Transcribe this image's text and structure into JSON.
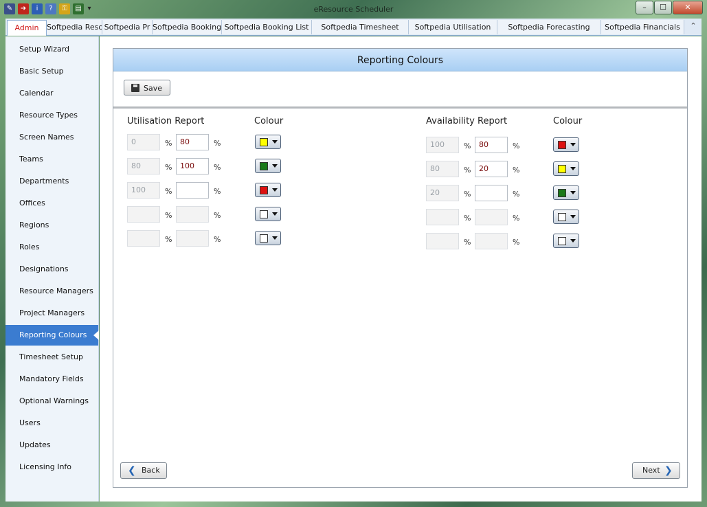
{
  "window": {
    "title": "eResource Scheduler"
  },
  "tabs": [
    "Admin",
    "Softpedia Reso",
    "Softpedia Pr",
    "Softpedia Booking",
    "Softpedia Booking List",
    "Softpedia Timesheet",
    "Softpedia Utilisation",
    "Softpedia Forecasting",
    "Softpedia Financials"
  ],
  "sidebar": [
    "Setup Wizard",
    "Basic Setup",
    "Calendar",
    "Resource Types",
    "Screen Names",
    "Teams",
    "Departments",
    "Offices",
    "Regions",
    "Roles",
    "Designations",
    "Resource Managers",
    "Project Managers",
    "Reporting Colours",
    "Timesheet Setup",
    "Mandatory Fields",
    "Optional Warnings",
    "Users",
    "Updates",
    "Licensing Info"
  ],
  "active_sidebar": "Reporting Colours",
  "panel": {
    "title": "Reporting Colours",
    "save_label": "Save",
    "back_label": "Back",
    "next_label": "Next"
  },
  "utilisation": {
    "heading": "Utilisation Report",
    "colour_heading": "Colour",
    "rows": [
      {
        "from": "0",
        "to": "80",
        "colour": "#ffff00"
      },
      {
        "from": "80",
        "to": "100",
        "colour": "#1a7a1a"
      },
      {
        "from": "100",
        "to": "",
        "colour": "#dd1111"
      },
      {
        "from": "",
        "to": "",
        "colour": "#ffffff"
      },
      {
        "from": "",
        "to": "",
        "colour": "#ffffff"
      }
    ]
  },
  "availability": {
    "heading": "Availability Report",
    "colour_heading": "Colour",
    "rows": [
      {
        "from": "100",
        "to": "80",
        "colour": "#dd1111"
      },
      {
        "from": "80",
        "to": "20",
        "colour": "#ffff00"
      },
      {
        "from": "20",
        "to": "",
        "colour": "#1a7a1a"
      },
      {
        "from": "",
        "to": "",
        "colour": "#ffffff"
      },
      {
        "from": "",
        "to": "",
        "colour": "#ffffff"
      }
    ]
  },
  "pct_symbol": "%"
}
